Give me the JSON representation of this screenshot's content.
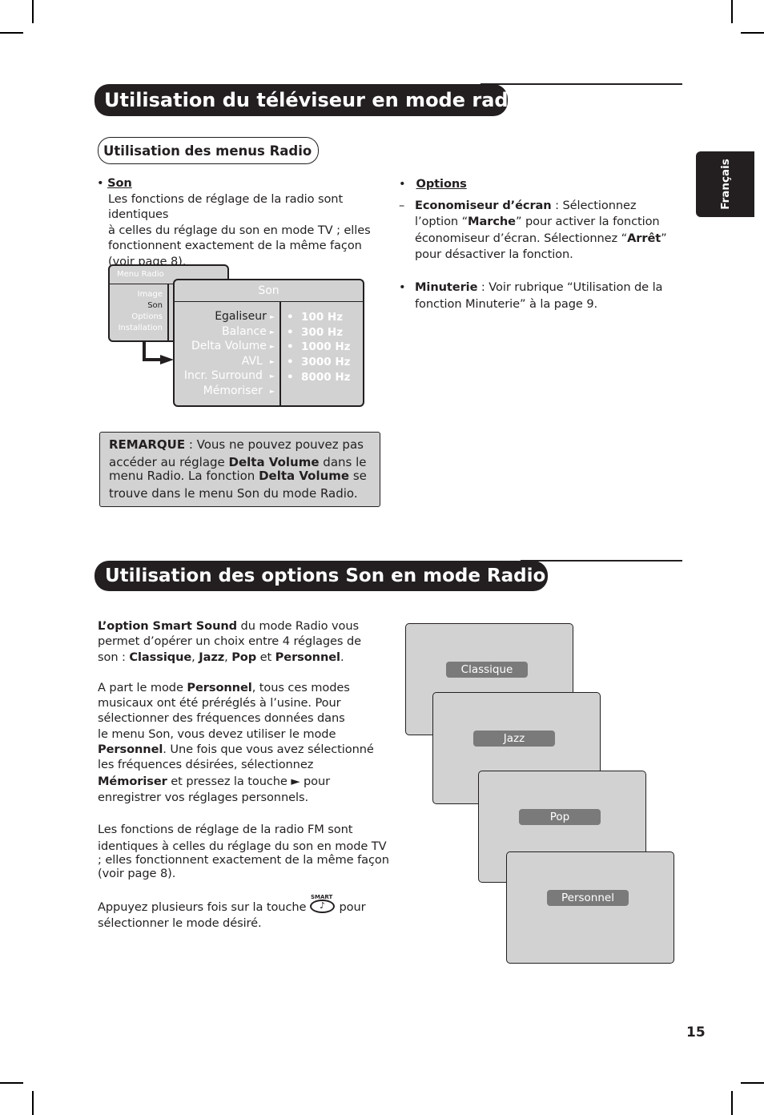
{
  "side_tab": {
    "language": "Français"
  },
  "section1": {
    "title": "Utilisation du téléviseur en mode radio",
    "subtitle": "Utilisation des menus Radio",
    "son": {
      "bullet": "•",
      "heading": "Son",
      "lines": [
        "Les fonctions de réglage de la radio sont identiques",
        "à celles du réglage du son en mode TV ; elles",
        "fonctionnent exactement de la même façon",
        "(voir page 8)."
      ]
    },
    "menu_radio": {
      "title": "Menu Radio",
      "items": [
        "Image",
        "Son",
        "Options",
        "Installation"
      ]
    },
    "son_menu": {
      "title": "Son",
      "items": [
        "Egaliseur",
        "Balance",
        "Delta Volume",
        "AVL",
        "Incr. Surround",
        "Mémoriser"
      ],
      "arrow": "►",
      "frequencies": [
        "100 Hz",
        "300 Hz",
        "1000 Hz",
        "3000 Hz",
        "8000 Hz"
      ],
      "freq_bullet": "•"
    },
    "remark": {
      "label": "REMARQUE",
      "t1": " : Vous ne pouvez pouvez pas",
      "t2": "accéder au réglage ",
      "b2": "Delta Volume",
      "t3": " dans le",
      "t4": "menu Radio. La fonction ",
      "b4": "Delta Volume",
      "t5": " se",
      "t6": "trouve dans le menu Son du mode Radio."
    },
    "options": {
      "bullet": "•",
      "heading": "Options",
      "dash": "–",
      "eco_label": "Economiseur d’écran",
      "eco_t1": " : Sélectionnez",
      "eco_t2a": "l’option “",
      "eco_marche": "Marche",
      "eco_t2b": "” pour activer la fonction",
      "eco_t3a": "économiseur d’écran. Sélectionnez “",
      "eco_arret": "Arrêt",
      "eco_t3b": "”",
      "eco_t4": "pour désactiver la fonction.",
      "min_label": "Minuterie",
      "min_t1": " : Voir rubrique “Utilisation de la",
      "min_t2": "fonction Minuterie” à la page 9."
    }
  },
  "section2": {
    "title": "Utilisation des options Son en mode Radio",
    "p1": {
      "b1": "L’option Smart Sound",
      "t1": " du mode Radio vous",
      "t2": "permet d’opérer un choix entre 4 réglages de",
      "t3": "son : ",
      "c": "Classique",
      "comma": ", ",
      "j": "Jazz",
      "p": "Pop",
      "et": " et ",
      "pe": "Personnel",
      "dot": "."
    },
    "p2": {
      "t1": "A part le mode ",
      "b1": "Personnel",
      "t1b": ", tous ces modes",
      "t2": "musicaux ont été préréglés à l’usine. Pour",
      "t3": "sélectionner des fréquences données dans",
      "t4": "le menu Son, vous devez utiliser le mode",
      "b5": "Personnel",
      "t5": ". Une fois que vous avez sélectionné",
      "t6": "les fréquences désirées, sélectionnez",
      "b7": "Mémoriser",
      "t7": " et pressez la touche ► pour",
      "t8": "enregistrer vos réglages personnels."
    },
    "p3": [
      "Les fonctions de réglage de la radio FM sont",
      "identiques à celles du réglage du son en mode TV",
      "; elles fonctionnent exactement de la même façon",
      "(voir page 8)."
    ],
    "p4": {
      "t1": "Appuyez plusieurs fois sur la touche ",
      "button_label": "SMART",
      "button_glyph": "♪",
      "t1b": " pour",
      "t2": "sélectionner le mode désiré."
    },
    "modes": [
      "Classique",
      "Jazz",
      "Pop",
      "Personnel"
    ]
  },
  "page_number": "15"
}
